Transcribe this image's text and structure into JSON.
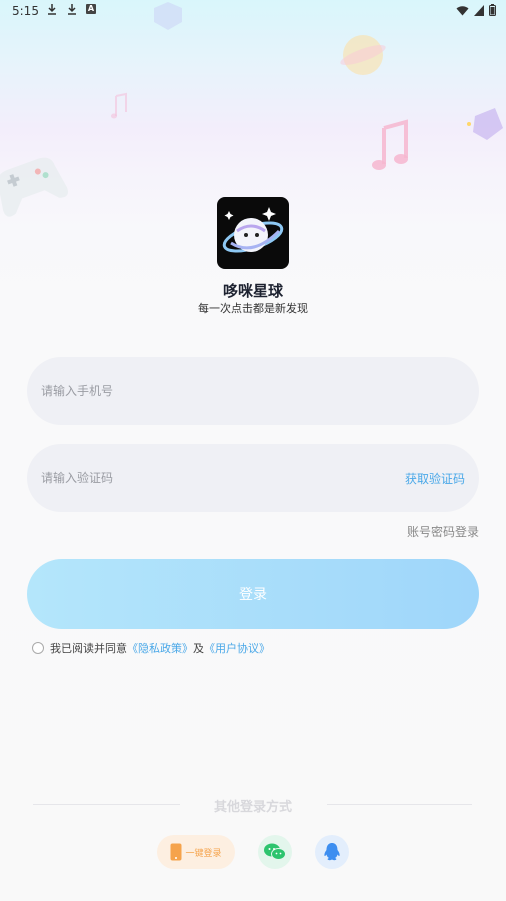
{
  "status_bar": {
    "time": "5:15",
    "left_icons": [
      "download-icon",
      "download-icon",
      "a-letter-icon"
    ],
    "right_icons": [
      "wifi-icon",
      "signal-icon",
      "battery-icon"
    ]
  },
  "app": {
    "name": "哆咪星球",
    "slogan": "每一次点击都是新发现"
  },
  "form": {
    "phone_placeholder": "请输入手机号",
    "code_placeholder": "请输入验证码",
    "get_code_label": "获取验证码",
    "password_login_label": "账号密码登录",
    "login_label": "登录"
  },
  "agreement": {
    "prefix": "我已阅读并同意",
    "privacy_link": "《隐私政策》",
    "and": "及",
    "terms_link": "《用户协议》",
    "checked": false
  },
  "other_login": {
    "title": "其他登录方式",
    "one_key_label": "一键登录",
    "options": [
      "phone-icon",
      "wechat-icon",
      "qq-icon"
    ]
  },
  "colors": {
    "accent": "#4aa8e8",
    "login_button": "#a6dbfa",
    "one_key": "#f5a34c",
    "wechat": "#2dc46e",
    "qq": "#3d8ef0"
  }
}
